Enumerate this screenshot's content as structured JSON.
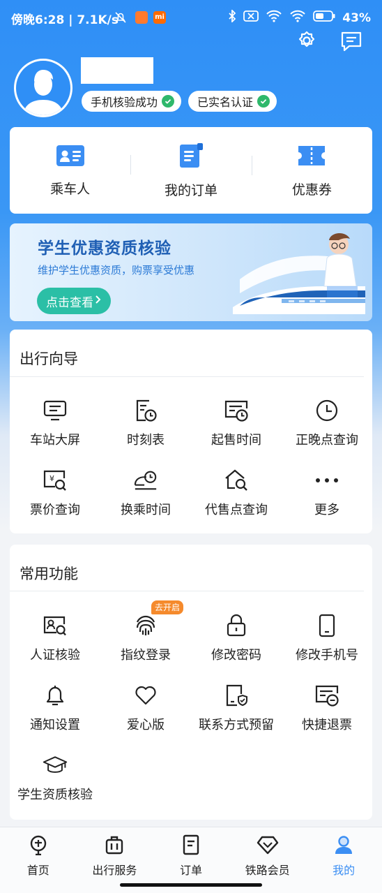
{
  "status_bar": {
    "time_speed": "傍晚6:28 | 7.1K/s",
    "battery": "43%"
  },
  "header": {
    "settings_icon": "gear-icon",
    "message_icon": "message-icon",
    "badges": [
      {
        "label": "手机核验成功"
      },
      {
        "label": "已实名认证"
      }
    ]
  },
  "quick_links": [
    {
      "label": "乘车人",
      "icon": "passenger-card-icon"
    },
    {
      "label": "我的订单",
      "icon": "order-document-icon"
    },
    {
      "label": "优惠券",
      "icon": "coupon-icon"
    }
  ],
  "banner": {
    "title": "学生优惠资质核验",
    "subtitle": "维护学生优惠资质，购票享受优惠",
    "button": "点击查看"
  },
  "travel_guide": {
    "title": "出行向导",
    "items": [
      {
        "label": "车站大屏",
        "icon": "monitor-icon"
      },
      {
        "label": "时刻表",
        "icon": "timetable-icon"
      },
      {
        "label": "起售时间",
        "icon": "sale-time-icon"
      },
      {
        "label": "正晚点查询",
        "icon": "clock-icon"
      },
      {
        "label": "票价查询",
        "icon": "fare-search-icon"
      },
      {
        "label": "换乘时间",
        "icon": "transfer-time-icon"
      },
      {
        "label": "代售点查询",
        "icon": "agency-search-icon"
      },
      {
        "label": "更多",
        "icon": "more-dots-icon"
      }
    ]
  },
  "common_functions": {
    "title": "常用功能",
    "fingerprint_tag": "去开启",
    "items": [
      {
        "label": "人证核验",
        "icon": "id-verify-icon"
      },
      {
        "label": "指纹登录",
        "icon": "fingerprint-icon"
      },
      {
        "label": "修改密码",
        "icon": "lock-icon"
      },
      {
        "label": "修改手机号",
        "icon": "phone-icon"
      },
      {
        "label": "通知设置",
        "icon": "bell-icon"
      },
      {
        "label": "爱心版",
        "icon": "heart-icon"
      },
      {
        "label": "联系方式预留",
        "icon": "contact-shield-icon"
      },
      {
        "label": "快捷退票",
        "icon": "refund-ticket-icon"
      },
      {
        "label": "学生资质核验",
        "icon": "graduation-cap-icon"
      }
    ]
  },
  "tab_bar": [
    {
      "label": "首页",
      "icon": "home-train-icon"
    },
    {
      "label": "出行服务",
      "icon": "luggage-icon"
    },
    {
      "label": "订单",
      "icon": "order-list-icon"
    },
    {
      "label": "铁路会员",
      "icon": "diamond-icon"
    },
    {
      "label": "我的",
      "icon": "user-icon",
      "active": true
    }
  ],
  "colors": {
    "primary_blue": "#3b8ef3",
    "success_green": "#2fb86b",
    "tag_orange": "#f58a2c",
    "banner_button": "#2bbfa6"
  }
}
